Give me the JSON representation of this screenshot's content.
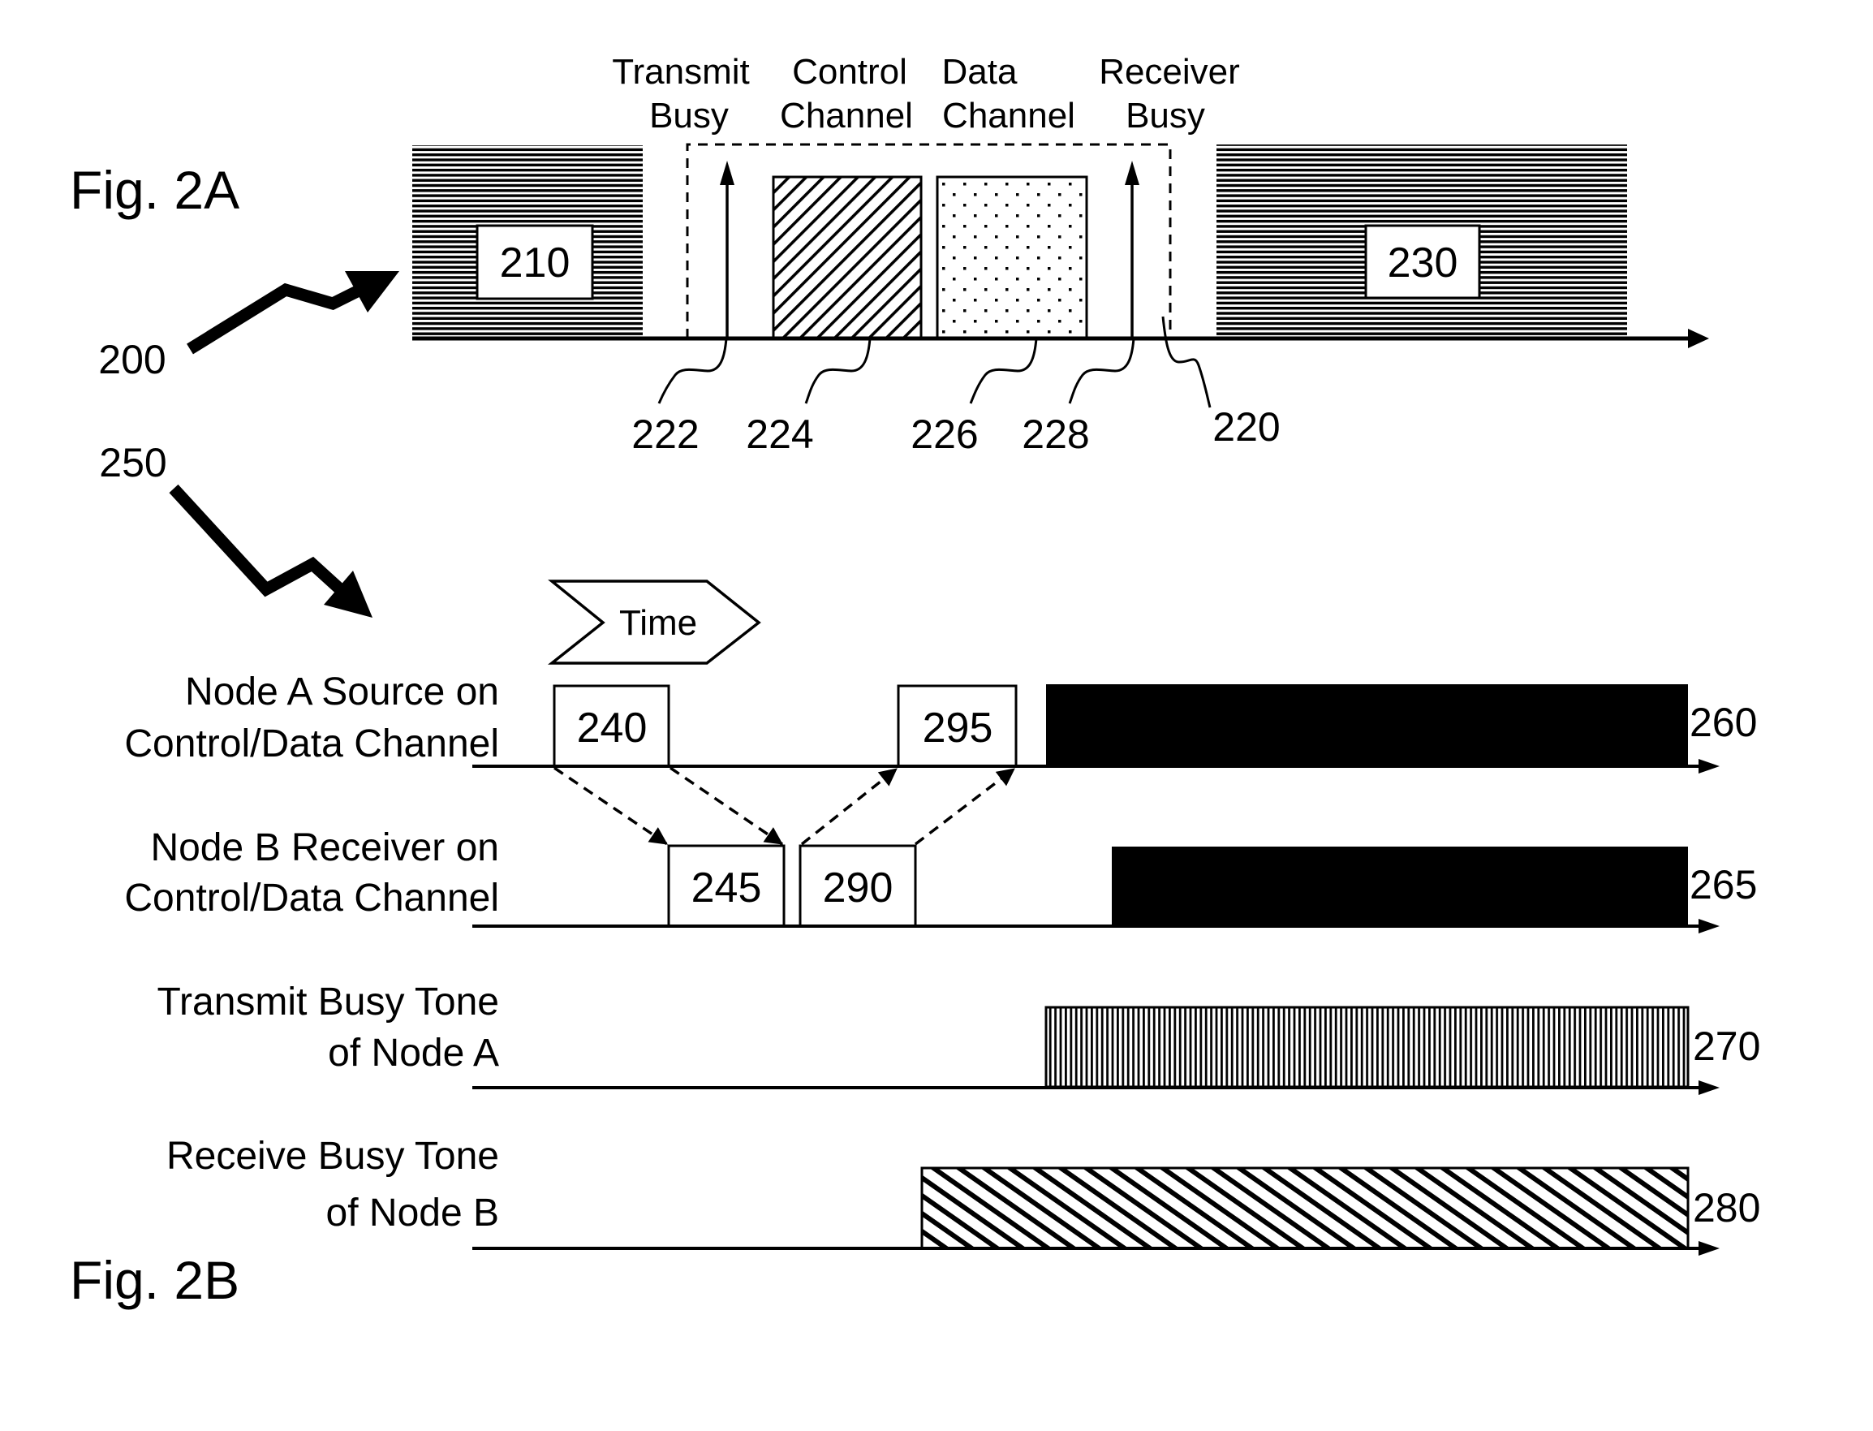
{
  "figure_2a": {
    "fig_label": "Fig. 2A",
    "ref_label": "200",
    "headers": {
      "transmit_busy": [
        "Transmit",
        "Busy"
      ],
      "control_channel": [
        "Control",
        "Channel"
      ],
      "data_channel": [
        "Data",
        "Channel"
      ],
      "receiver_busy": [
        "Receiver",
        "Busy"
      ]
    },
    "blocks": {
      "left": "210",
      "right": "230"
    },
    "refs": {
      "transmit_busy_arrow": "222",
      "control_channel": "224",
      "data_channel": "226",
      "receiver_busy_arrow": "228",
      "handshake_window": "220"
    }
  },
  "figure_2b": {
    "fig_label": "Fig. 2B",
    "ref_label": "250",
    "time_label": "Time",
    "rows": [
      {
        "label": [
          "Node A Source on",
          "Control/Data Channel"
        ],
        "ref": "260",
        "fill": "solid-black"
      },
      {
        "label": [
          "Node B Receiver on",
          "Control/Data Channel"
        ],
        "ref": "265",
        "fill": "solid-black"
      },
      {
        "label": [
          "Transmit Busy Tone",
          "of Node A"
        ],
        "ref": "270",
        "fill": "vertical-hatch"
      },
      {
        "label": [
          "Receive Busy Tone",
          "of Node B"
        ],
        "ref": "280",
        "fill": "diagonal-hatch"
      }
    ],
    "packets": {
      "node_a_first": "240",
      "node_a_second": "295",
      "node_b_first": "245",
      "node_b_second": "290"
    }
  },
  "colors": {
    "ink": "#000000",
    "paper": "#ffffff"
  }
}
